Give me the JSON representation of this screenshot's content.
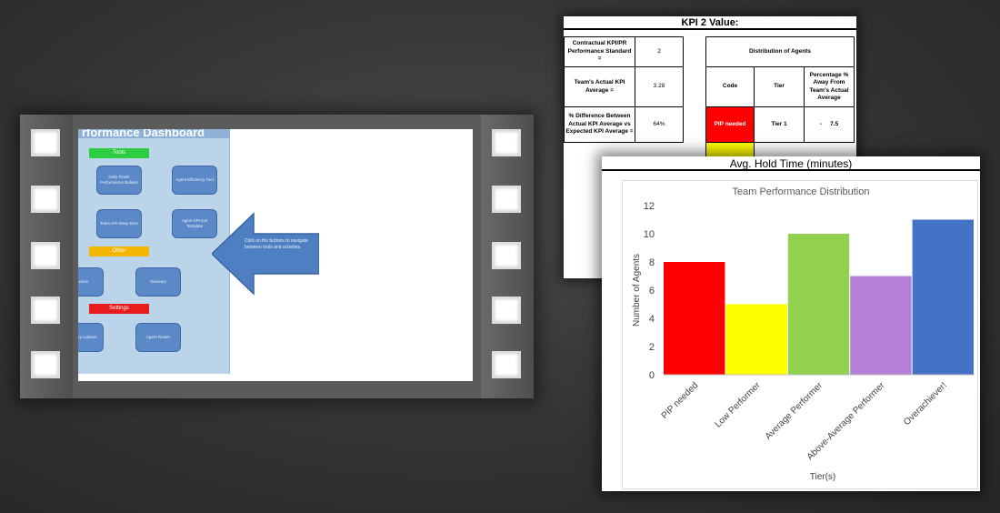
{
  "film": {
    "panel_title": "rformance Dashboard",
    "categories": [
      {
        "label": "Tools",
        "color": "#2ecc40"
      },
      {
        "label": "Other",
        "color": "#f2b705"
      },
      {
        "label": "Settings",
        "color": "#e81c1c"
      }
    ],
    "buttons": [
      "Daily Finish Performance Bulletin",
      "Agent Efficiency Tool",
      "Team KPI Deep Dive",
      "Agent KPI Dot Template",
      "al uction",
      "Glossary",
      "Accuracy culation",
      "Agent Roster"
    ],
    "arrow_text": "Click on the buttons to navigate between tools and activities."
  },
  "kpi": {
    "title": "KPI 2 Value:",
    "rows": [
      {
        "label": "Contractual KPI/PR Performance Standard =",
        "value": "2"
      },
      {
        "label": "Team's Actual KPI Average =",
        "value": "3.28"
      },
      {
        "label": "% Difference Between Actual KPI Average vs Expected KPI Average =",
        "value": "64%"
      }
    ],
    "distribution": {
      "title": "Distribution of Agents",
      "headers": [
        "Code",
        "Tier",
        "Percentage % Away From Team's Actual Average"
      ],
      "row": {
        "code": "PIP needed",
        "tier": "Tier 1",
        "pct": "-     7.5"
      },
      "code_colors": [
        "#ff0000",
        "#ffff00"
      ]
    }
  },
  "chart": {
    "hold_label": "Avg. Hold Time (minutes)"
  },
  "chart_data": {
    "type": "bar",
    "title": "Team Performance Distribution",
    "xlabel": "Tier(s)",
    "ylabel": "Number of Agents",
    "categories": [
      "PIP needed",
      "Low Performer",
      "Average Performer",
      "Above-Average Performer",
      "Overachiever!"
    ],
    "values": [
      8,
      5,
      10,
      7,
      11
    ],
    "colors": [
      "#ff0000",
      "#ffff00",
      "#92d050",
      "#b57fd8",
      "#4472c4"
    ],
    "ylim": [
      0,
      12
    ],
    "yticks": [
      "0",
      "2",
      "4",
      "6",
      "8",
      "10",
      "12"
    ],
    "grid": false
  }
}
